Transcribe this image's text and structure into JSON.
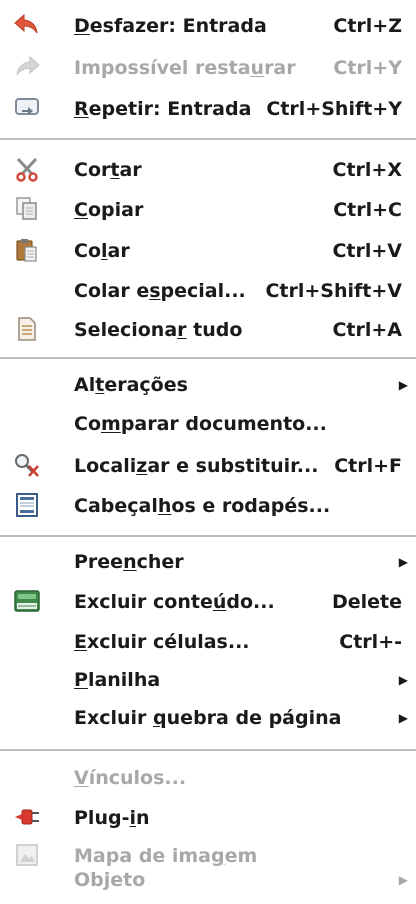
{
  "menu": {
    "items": [
      {
        "id": "undo",
        "pre": "",
        "ul": "D",
        "post": "esfazer: Entrada",
        "shortcut": "Ctrl+Z",
        "icon": "undo-icon",
        "enabled": true,
        "submenu": false
      },
      {
        "id": "redo",
        "pre": "Impossível resta",
        "ul": "u",
        "post": "rar",
        "shortcut": "Ctrl+Y",
        "icon": "redo-icon",
        "enabled": false,
        "submenu": false
      },
      {
        "id": "repeat",
        "pre": "",
        "ul": "R",
        "post": "epetir: Entrada",
        "shortcut": "Ctrl+Shift+Y",
        "icon": "repeat-icon",
        "enabled": true,
        "submenu": false
      },
      {
        "id": "cut",
        "pre": "Cor",
        "ul": "t",
        "post": "ar",
        "shortcut": "Ctrl+X",
        "icon": "scissors-icon",
        "enabled": true,
        "submenu": false
      },
      {
        "id": "copy",
        "pre": "",
        "ul": "C",
        "post": "opiar",
        "shortcut": "Ctrl+C",
        "icon": "copy-icon",
        "enabled": true,
        "submenu": false
      },
      {
        "id": "paste",
        "pre": "Co",
        "ul": "l",
        "post": "ar",
        "shortcut": "Ctrl+V",
        "icon": "clipboard-icon",
        "enabled": true,
        "submenu": false
      },
      {
        "id": "paste-special",
        "pre": "Colar e",
        "ul": "s",
        "post": "pecial...",
        "shortcut": "Ctrl+Shift+V",
        "icon": "",
        "enabled": true,
        "submenu": false
      },
      {
        "id": "select-all",
        "pre": "Seleciona",
        "ul": "r",
        "post": " tudo",
        "shortcut": "Ctrl+A",
        "icon": "select-all-icon",
        "enabled": true,
        "submenu": false
      },
      {
        "id": "changes",
        "pre": "Al",
        "ul": "t",
        "post": "erações",
        "shortcut": "",
        "icon": "",
        "enabled": true,
        "submenu": true
      },
      {
        "id": "compare",
        "pre": "Co",
        "ul": "m",
        "post": "parar documento...",
        "shortcut": "",
        "icon": "",
        "enabled": true,
        "submenu": false
      },
      {
        "id": "find-replace",
        "pre": "Locali",
        "ul": "z",
        "post": "ar e substituir...",
        "shortcut": "Ctrl+F",
        "icon": "find-replace-icon",
        "enabled": true,
        "submenu": false
      },
      {
        "id": "headers-footers",
        "pre": "Cabeçal",
        "ul": "h",
        "post": "os e rodapés...",
        "shortcut": "",
        "icon": "headers-footers-icon",
        "enabled": true,
        "submenu": false
      },
      {
        "id": "fill",
        "pre": "Pree",
        "ul": "n",
        "post": "cher",
        "shortcut": "",
        "icon": "",
        "enabled": true,
        "submenu": true
      },
      {
        "id": "delete-contents",
        "pre": "Excluir conte",
        "ul": "ú",
        "post": "do...",
        "shortcut": "Delete",
        "icon": "delete-contents-icon",
        "enabled": true,
        "submenu": false
      },
      {
        "id": "delete-cells",
        "pre": "",
        "ul": "E",
        "post": "xcluir células...",
        "shortcut": "Ctrl+-",
        "icon": "",
        "enabled": true,
        "submenu": false
      },
      {
        "id": "sheet",
        "pre": "",
        "ul": "P",
        "post": "lanilha",
        "shortcut": "",
        "icon": "",
        "enabled": true,
        "submenu": true
      },
      {
        "id": "delete-page-break",
        "pre": "Excluir ",
        "ul": "q",
        "post": "uebra de página",
        "shortcut": "",
        "icon": "",
        "enabled": true,
        "submenu": true
      },
      {
        "id": "links",
        "pre": "",
        "ul": "V",
        "post": "ínculos...",
        "shortcut": "",
        "icon": "",
        "enabled": false,
        "submenu": false
      },
      {
        "id": "plugin",
        "pre": "Plug-",
        "ul": "i",
        "post": "n",
        "shortcut": "",
        "icon": "plugin-icon",
        "enabled": true,
        "submenu": false
      },
      {
        "id": "image-map",
        "pre": "Mapa de ima",
        "ul": "g",
        "post": "em",
        "shortcut": "",
        "icon": "image-map-icon",
        "enabled": false,
        "submenu": false
      },
      {
        "id": "object",
        "pre": "Objeto",
        "ul": "",
        "post": "",
        "shortcut": "",
        "icon": "",
        "enabled": false,
        "submenu": true
      }
    ],
    "submenu_arrow": "▶"
  }
}
